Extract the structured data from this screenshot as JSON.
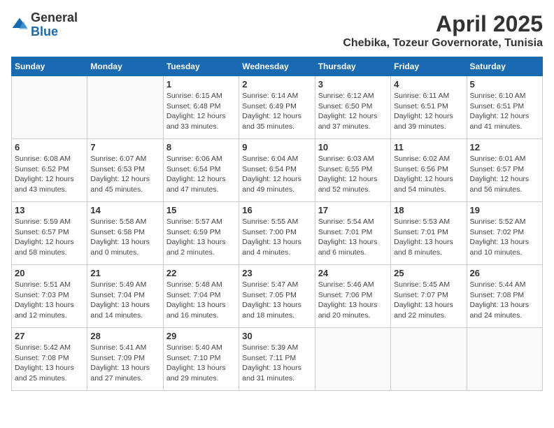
{
  "logo": {
    "text_general": "General",
    "text_blue": "Blue"
  },
  "title": "April 2025",
  "location": "Chebika, Tozeur Governorate, Tunisia",
  "days_of_week": [
    "Sunday",
    "Monday",
    "Tuesday",
    "Wednesday",
    "Thursday",
    "Friday",
    "Saturday"
  ],
  "weeks": [
    [
      {
        "day": "",
        "info": ""
      },
      {
        "day": "",
        "info": ""
      },
      {
        "day": "1",
        "info": "Sunrise: 6:15 AM\nSunset: 6:48 PM\nDaylight: 12 hours and 33 minutes."
      },
      {
        "day": "2",
        "info": "Sunrise: 6:14 AM\nSunset: 6:49 PM\nDaylight: 12 hours and 35 minutes."
      },
      {
        "day": "3",
        "info": "Sunrise: 6:12 AM\nSunset: 6:50 PM\nDaylight: 12 hours and 37 minutes."
      },
      {
        "day": "4",
        "info": "Sunrise: 6:11 AM\nSunset: 6:51 PM\nDaylight: 12 hours and 39 minutes."
      },
      {
        "day": "5",
        "info": "Sunrise: 6:10 AM\nSunset: 6:51 PM\nDaylight: 12 hours and 41 minutes."
      }
    ],
    [
      {
        "day": "6",
        "info": "Sunrise: 6:08 AM\nSunset: 6:52 PM\nDaylight: 12 hours and 43 minutes."
      },
      {
        "day": "7",
        "info": "Sunrise: 6:07 AM\nSunset: 6:53 PM\nDaylight: 12 hours and 45 minutes."
      },
      {
        "day": "8",
        "info": "Sunrise: 6:06 AM\nSunset: 6:54 PM\nDaylight: 12 hours and 47 minutes."
      },
      {
        "day": "9",
        "info": "Sunrise: 6:04 AM\nSunset: 6:54 PM\nDaylight: 12 hours and 49 minutes."
      },
      {
        "day": "10",
        "info": "Sunrise: 6:03 AM\nSunset: 6:55 PM\nDaylight: 12 hours and 52 minutes."
      },
      {
        "day": "11",
        "info": "Sunrise: 6:02 AM\nSunset: 6:56 PM\nDaylight: 12 hours and 54 minutes."
      },
      {
        "day": "12",
        "info": "Sunrise: 6:01 AM\nSunset: 6:57 PM\nDaylight: 12 hours and 56 minutes."
      }
    ],
    [
      {
        "day": "13",
        "info": "Sunrise: 5:59 AM\nSunset: 6:57 PM\nDaylight: 12 hours and 58 minutes."
      },
      {
        "day": "14",
        "info": "Sunrise: 5:58 AM\nSunset: 6:58 PM\nDaylight: 13 hours and 0 minutes."
      },
      {
        "day": "15",
        "info": "Sunrise: 5:57 AM\nSunset: 6:59 PM\nDaylight: 13 hours and 2 minutes."
      },
      {
        "day": "16",
        "info": "Sunrise: 5:55 AM\nSunset: 7:00 PM\nDaylight: 13 hours and 4 minutes."
      },
      {
        "day": "17",
        "info": "Sunrise: 5:54 AM\nSunset: 7:01 PM\nDaylight: 13 hours and 6 minutes."
      },
      {
        "day": "18",
        "info": "Sunrise: 5:53 AM\nSunset: 7:01 PM\nDaylight: 13 hours and 8 minutes."
      },
      {
        "day": "19",
        "info": "Sunrise: 5:52 AM\nSunset: 7:02 PM\nDaylight: 13 hours and 10 minutes."
      }
    ],
    [
      {
        "day": "20",
        "info": "Sunrise: 5:51 AM\nSunset: 7:03 PM\nDaylight: 13 hours and 12 minutes."
      },
      {
        "day": "21",
        "info": "Sunrise: 5:49 AM\nSunset: 7:04 PM\nDaylight: 13 hours and 14 minutes."
      },
      {
        "day": "22",
        "info": "Sunrise: 5:48 AM\nSunset: 7:04 PM\nDaylight: 13 hours and 16 minutes."
      },
      {
        "day": "23",
        "info": "Sunrise: 5:47 AM\nSunset: 7:05 PM\nDaylight: 13 hours and 18 minutes."
      },
      {
        "day": "24",
        "info": "Sunrise: 5:46 AM\nSunset: 7:06 PM\nDaylight: 13 hours and 20 minutes."
      },
      {
        "day": "25",
        "info": "Sunrise: 5:45 AM\nSunset: 7:07 PM\nDaylight: 13 hours and 22 minutes."
      },
      {
        "day": "26",
        "info": "Sunrise: 5:44 AM\nSunset: 7:08 PM\nDaylight: 13 hours and 24 minutes."
      }
    ],
    [
      {
        "day": "27",
        "info": "Sunrise: 5:42 AM\nSunset: 7:08 PM\nDaylight: 13 hours and 25 minutes."
      },
      {
        "day": "28",
        "info": "Sunrise: 5:41 AM\nSunset: 7:09 PM\nDaylight: 13 hours and 27 minutes."
      },
      {
        "day": "29",
        "info": "Sunrise: 5:40 AM\nSunset: 7:10 PM\nDaylight: 13 hours and 29 minutes."
      },
      {
        "day": "30",
        "info": "Sunrise: 5:39 AM\nSunset: 7:11 PM\nDaylight: 13 hours and 31 minutes."
      },
      {
        "day": "",
        "info": ""
      },
      {
        "day": "",
        "info": ""
      },
      {
        "day": "",
        "info": ""
      }
    ]
  ]
}
